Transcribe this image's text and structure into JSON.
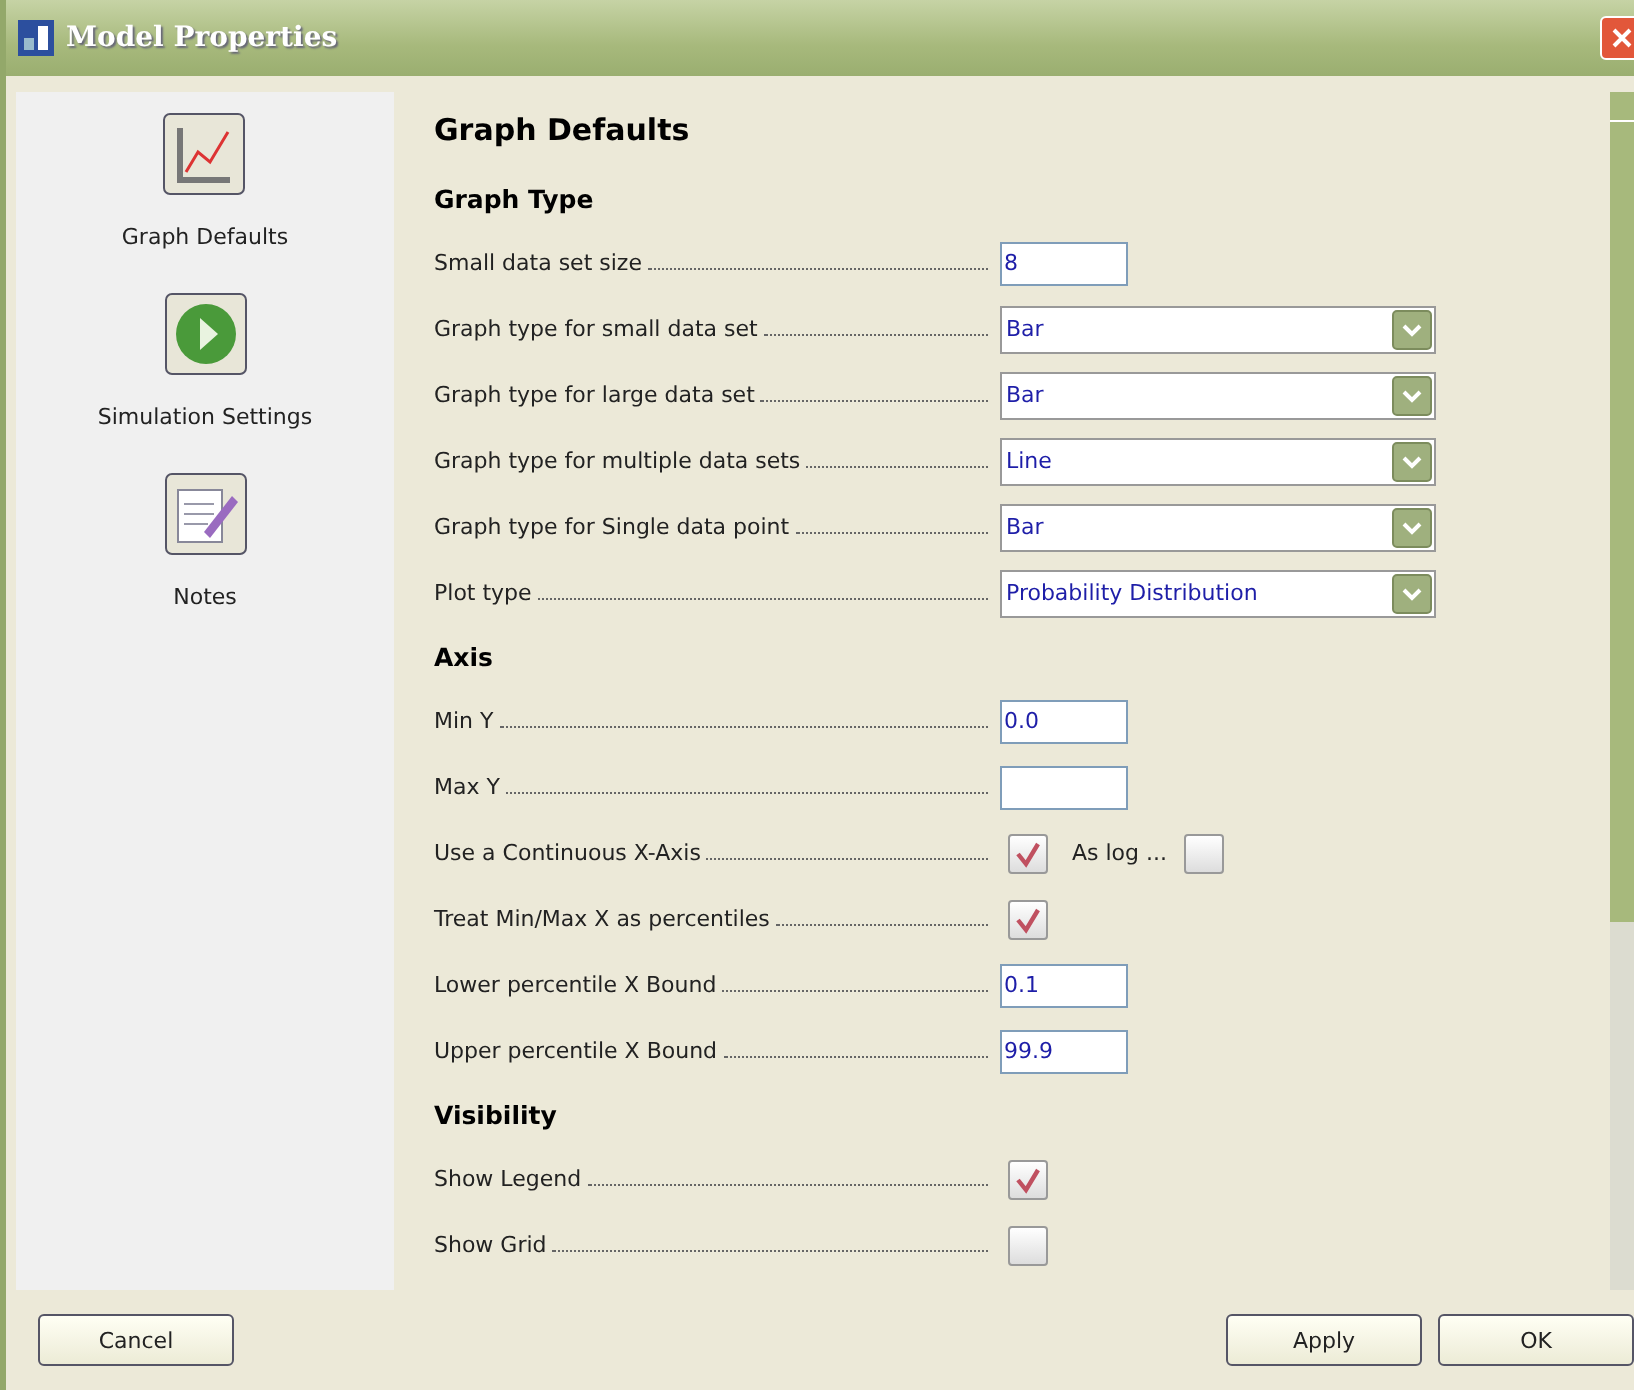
{
  "window": {
    "title": "Model Properties"
  },
  "sidebar": {
    "items": [
      {
        "label": "Graph Defaults",
        "kind": "graph"
      },
      {
        "label": "Simulation Settings",
        "kind": "play"
      },
      {
        "label": "Notes",
        "kind": "notes"
      }
    ]
  },
  "panel": {
    "title": "Graph Defaults",
    "sections": [
      {
        "title": "Graph Type",
        "rows": [
          {
            "label": "Small data set size",
            "kind": "text",
            "value": "8"
          },
          {
            "label": "Graph type for small data set",
            "kind": "dropdown",
            "value": "Bar"
          },
          {
            "label": "Graph type for large data set",
            "kind": "dropdown",
            "value": "Bar"
          },
          {
            "label": "Graph type for multiple data sets",
            "kind": "dropdown",
            "value": "Line"
          },
          {
            "label": "Graph type for Single data point",
            "kind": "dropdown",
            "value": "Bar"
          },
          {
            "label": "Plot type",
            "kind": "dropdown",
            "value": "Probability Distribution"
          }
        ]
      },
      {
        "title": "Axis",
        "rows": [
          {
            "label": "Min Y",
            "kind": "text",
            "value": "0.0"
          },
          {
            "label": "Max Y",
            "kind": "text"
          },
          {
            "label": "Use a Continuous X-Axis",
            "kind": "checkbox",
            "checked": true,
            "extra": {
              "label": "As log ...",
              "checked": false
            }
          },
          {
            "label": "Treat Min/Max X as percentiles",
            "kind": "checkbox",
            "checked": true
          },
          {
            "label": "Lower percentile X Bound",
            "kind": "text",
            "value": "0.1"
          },
          {
            "label": "Upper percentile X Bound",
            "kind": "text",
            "value": "99.9"
          }
        ]
      },
      {
        "title": "Visibility",
        "rows": [
          {
            "label": "Show Legend",
            "kind": "checkbox",
            "checked": true
          },
          {
            "label": "Show Grid",
            "kind": "checkbox",
            "checked": false
          }
        ]
      }
    ]
  },
  "buttons": [
    {
      "label": "Cancel",
      "kind": "left"
    },
    {
      "label": "Apply",
      "kind": "right"
    },
    {
      "label": "OK",
      "kind": "right"
    }
  ]
}
